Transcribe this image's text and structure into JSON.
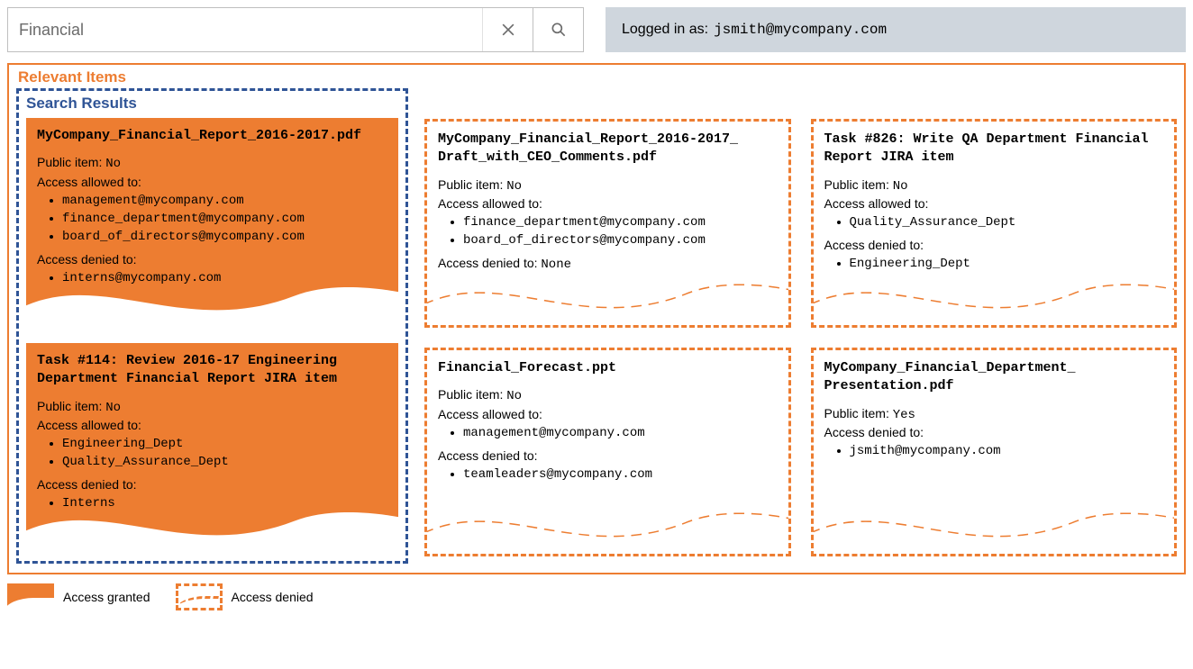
{
  "search": {
    "value": "Financial"
  },
  "login": {
    "prefix": "Logged in as:",
    "user": "jsmith@mycompany.com"
  },
  "panel": {
    "title": "Relevant Items"
  },
  "search_results": {
    "title": "Search Results"
  },
  "labels": {
    "public": "Public item:",
    "allowed": "Access allowed to:",
    "denied": "Access denied to:"
  },
  "legend": {
    "granted": "Access granted",
    "denied": "Access denied"
  },
  "cards": {
    "c0": {
      "title": "MyCompany_Financial_Report_2016-2017.pdf",
      "public": "No",
      "allowed": [
        "management@mycompany.com",
        "finance_department@mycompany.com",
        "board_of_directors@mycompany.com"
      ],
      "denied": [
        "interns@mycompany.com"
      ]
    },
    "c1": {
      "title": "Task #114: Review 2016-17 Engineering Department Financial Report JIRA item",
      "public": "No",
      "allowed": [
        "Engineering_Dept",
        "Quality_Assurance_Dept"
      ],
      "denied": [
        "Interns"
      ]
    },
    "c2": {
      "title": "MyCompany_Financial_Report_2016-2017_ Draft_with_CEO_Comments.pdf",
      "public": "No",
      "allowed": [
        "finance_department@mycompany.com",
        "board_of_directors@mycompany.com"
      ],
      "denied_inline": "None"
    },
    "c3": {
      "title": "Financial_Forecast.ppt",
      "public": "No",
      "allowed": [
        "management@mycompany.com"
      ],
      "denied": [
        "teamleaders@mycompany.com"
      ]
    },
    "c4": {
      "title": "Task #826: Write QA Department Financial Report JIRA item",
      "public": "No",
      "allowed": [
        "Quality_Assurance_Dept"
      ],
      "denied": [
        "Engineering_Dept"
      ]
    },
    "c5": {
      "title": "MyCompany_Financial_Department_ Presentation.pdf",
      "public": "Yes",
      "denied": [
        "jsmith@mycompany.com"
      ]
    }
  }
}
